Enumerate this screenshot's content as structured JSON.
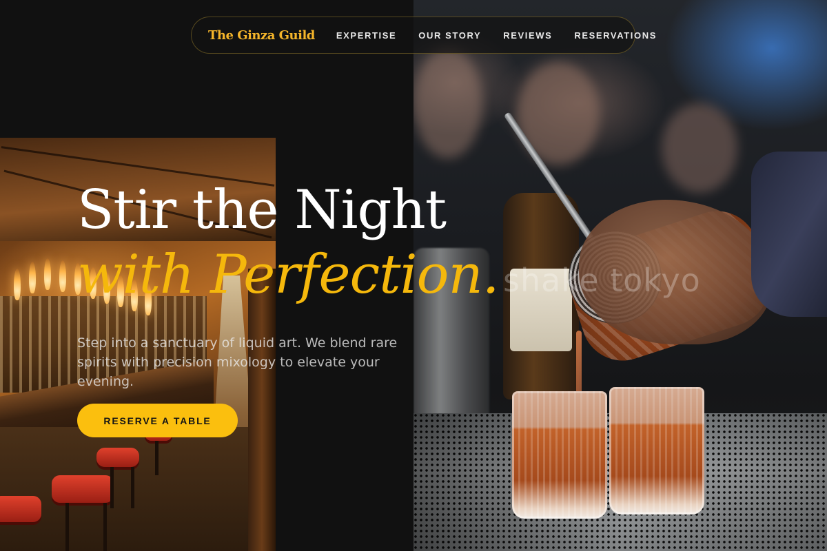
{
  "nav": {
    "brand": "The Ginza Guild",
    "links": [
      "EXPERTISE",
      "OUR STORY",
      "REVIEWS",
      "RESERVATIONS"
    ]
  },
  "hero": {
    "title_line1": "Stir the Night",
    "title_line2": "with Perfection.",
    "description": "Step into a sanctuary of liquid art. We blend rare spirits with precision mixology to elevate your evening.",
    "cta_label": "RESERVE A TABLE"
  },
  "images": {
    "left_photo": "bar-interior-photo",
    "right_photo": "bartender-pouring-photo",
    "watermark": "shake tokyo"
  },
  "colors": {
    "background": "#111111",
    "accent": "#f5b80c",
    "button": "#fbbf0e",
    "nav_text": "#e8e8e8"
  }
}
